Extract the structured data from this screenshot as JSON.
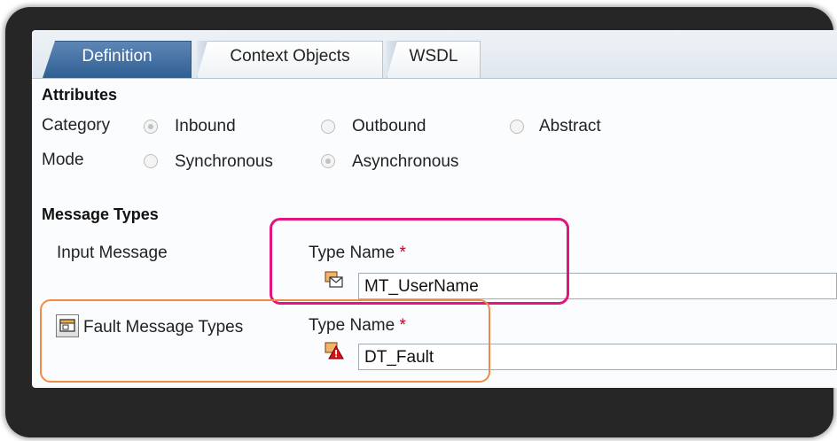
{
  "tabs": [
    {
      "label": "Definition",
      "active": true
    },
    {
      "label": "Context Objects",
      "active": false
    },
    {
      "label": "WSDL",
      "active": false
    }
  ],
  "attributes": {
    "title": "Attributes",
    "category": {
      "label": "Category",
      "options": [
        "Inbound",
        "Outbound",
        "Abstract"
      ],
      "selected": "Inbound"
    },
    "mode": {
      "label": "Mode",
      "options": [
        "Synchronous",
        "Asynchronous"
      ],
      "selected": "Asynchronous"
    }
  },
  "message_types": {
    "title": "Message Types",
    "input": {
      "label": "Input Message",
      "type_name_label": "Type Name",
      "required_mark": "*",
      "value": "MT_UserName",
      "icon": "message-type-icon"
    },
    "fault": {
      "label": "Fault Message Types",
      "type_name_label": "Type Name",
      "required_mark": "*",
      "value": "DT_Fault",
      "icon": "fault-data-type-icon"
    }
  },
  "colors": {
    "active_tab": "#2f5f94",
    "highlight_pink": "#e3137f",
    "highlight_orange": "#f08a46",
    "required": "#c0001a"
  }
}
